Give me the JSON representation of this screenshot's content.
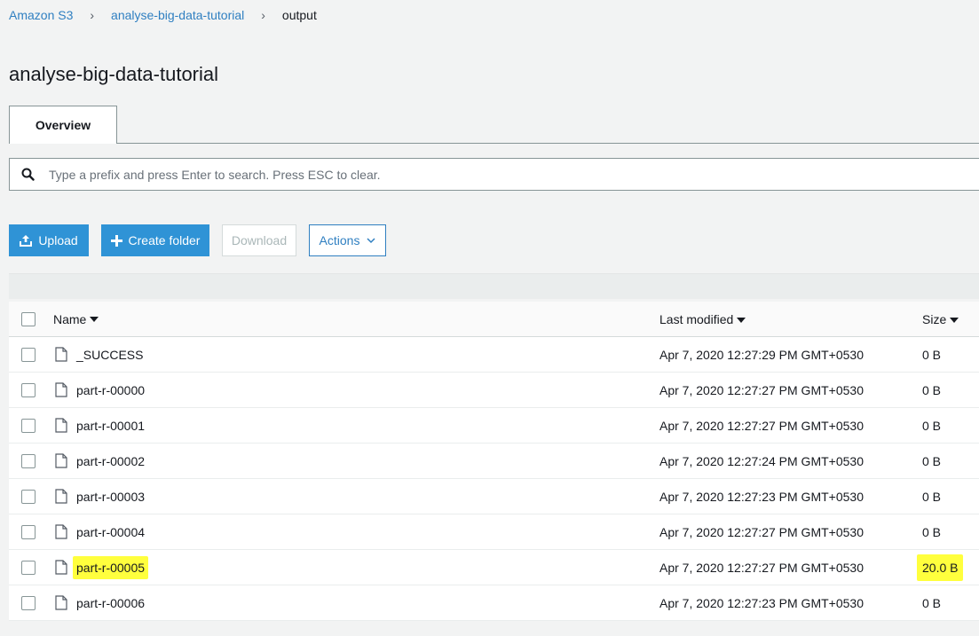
{
  "breadcrumb": {
    "root": "Amazon S3",
    "bucket": "analyse-big-data-tutorial",
    "current": "output",
    "separator": "›"
  },
  "page_title": "analyse-big-data-tutorial",
  "tabs": [
    {
      "label": "Overview",
      "active": true
    }
  ],
  "search": {
    "value": "",
    "placeholder": "Type a prefix and press Enter to search. Press ESC to clear."
  },
  "toolbar": {
    "upload_label": "Upload",
    "create_folder_label": "Create folder",
    "download_label": "Download",
    "actions_label": "Actions"
  },
  "table": {
    "columns": {
      "name": "Name",
      "last_modified": "Last modified",
      "size": "Size"
    },
    "rows": [
      {
        "name": "_SUCCESS",
        "modified": "Apr 7, 2020 12:27:29 PM GMT+0530",
        "size": "0 B"
      },
      {
        "name": "part-r-00000",
        "modified": "Apr 7, 2020 12:27:27 PM GMT+0530",
        "size": "0 B"
      },
      {
        "name": "part-r-00001",
        "modified": "Apr 7, 2020 12:27:27 PM GMT+0530",
        "size": "0 B"
      },
      {
        "name": "part-r-00002",
        "modified": "Apr 7, 2020 12:27:24 PM GMT+0530",
        "size": "0 B"
      },
      {
        "name": "part-r-00003",
        "modified": "Apr 7, 2020 12:27:23 PM GMT+0530",
        "size": "0 B"
      },
      {
        "name": "part-r-00004",
        "modified": "Apr 7, 2020 12:27:27 PM GMT+0530",
        "size": "0 B"
      },
      {
        "name": "part-r-00005",
        "modified": "Apr 7, 2020 12:27:27 PM GMT+0530",
        "size": "20.0 B",
        "highlighted": true
      },
      {
        "name": "part-r-00006",
        "modified": "Apr 7, 2020 12:27:23 PM GMT+0530",
        "size": "0 B"
      }
    ]
  },
  "colors": {
    "link": "#2f7fc1",
    "primary_button": "#2f93d6",
    "highlight": "#ffff3d"
  }
}
